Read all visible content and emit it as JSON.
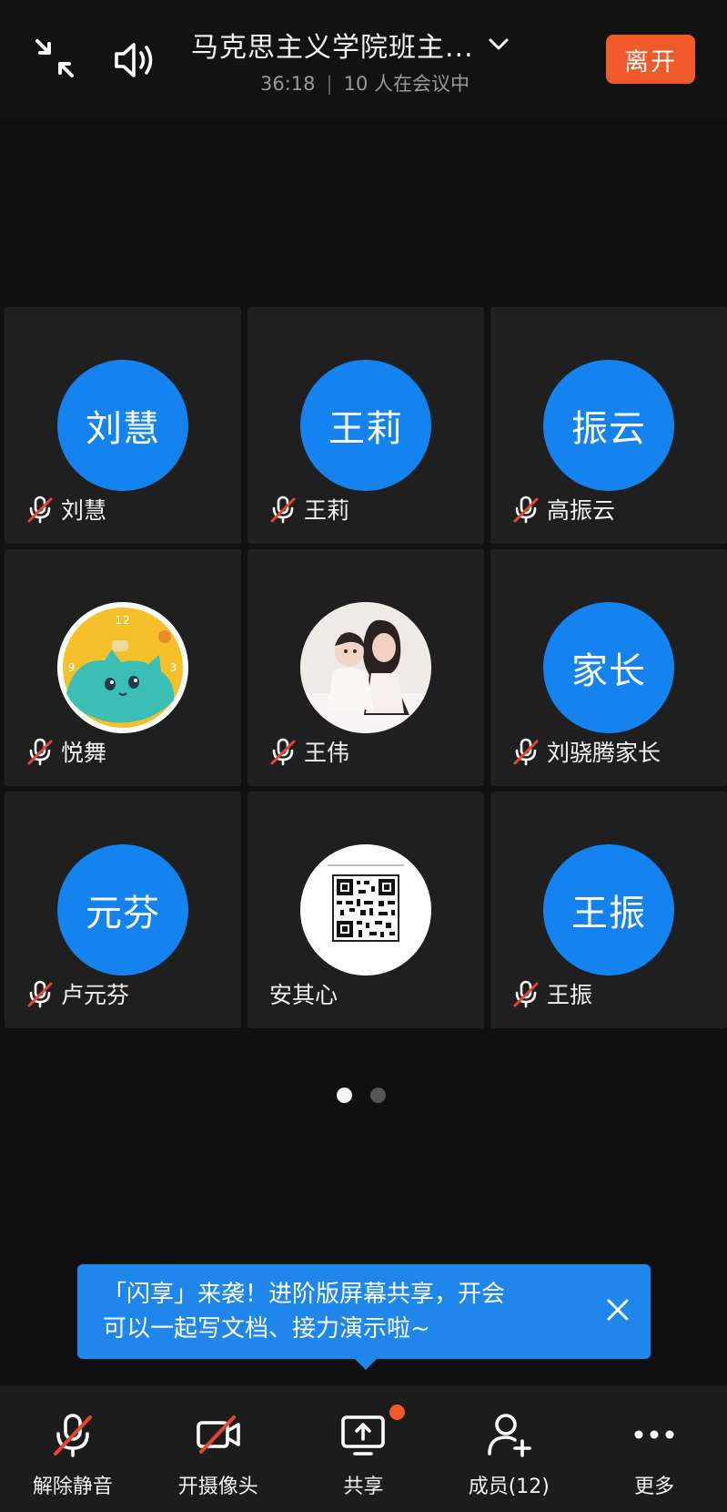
{
  "header": {
    "title": "马克思主义学院班主...",
    "duration": "36:18",
    "participants": "10 人在会议中",
    "leave_label": "离开"
  },
  "tiles": [
    {
      "avatar_text": "刘慧",
      "name": "刘慧",
      "muted": true
    },
    {
      "avatar_text": "王莉",
      "name": "王莉",
      "muted": true
    },
    {
      "avatar_text": "振云",
      "name": "高振云",
      "muted": true
    },
    {
      "avatar_text": "",
      "avatar_image": "cartoon-cat-clock",
      "name": "悦舞",
      "muted": true
    },
    {
      "avatar_text": "",
      "avatar_image": "mother-and-baby-photo",
      "name": "王伟",
      "muted": true
    },
    {
      "avatar_text": "家长",
      "name": "刘骁腾家长",
      "muted": true
    },
    {
      "avatar_text": "元芬",
      "name": "卢元芬",
      "muted": true
    },
    {
      "avatar_text": "",
      "avatar_image": "qr-code",
      "name": "安其心",
      "muted": false
    },
    {
      "avatar_text": "王振",
      "name": "王振",
      "muted": true
    }
  ],
  "pager": {
    "pages": 2,
    "current": 1
  },
  "banner": {
    "line1": "「闪享」来袭！进阶版屏幕共享，开会",
    "line2": "可以一起写文档、接力演示啦~"
  },
  "toolbar": {
    "unmute_label": "解除静音",
    "camera_label": "开摄像头",
    "share_label": "共享",
    "members_label": "成员(12)",
    "more_label": "更多"
  },
  "colors": {
    "accent_blue": "#1483f0",
    "leave_orange": "#f0592a",
    "muted_red": "#e8452c"
  }
}
